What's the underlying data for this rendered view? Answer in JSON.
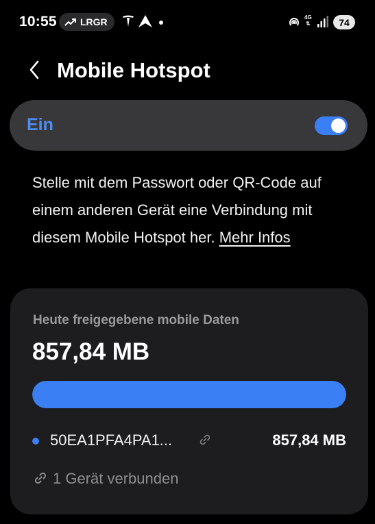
{
  "status_bar": {
    "time": "10:55",
    "pill_label": "LRGR",
    "pill_icon": "trending-up-icon",
    "network_type_top": "4G",
    "network_type_bottom": "⇅",
    "battery": "74"
  },
  "header": {
    "title": "Mobile Hotspot",
    "back_icon": "chevron-left-icon"
  },
  "toggle": {
    "label": "Ein",
    "state": "on",
    "accent_color": "#4f8cf0"
  },
  "description": {
    "text": "Stelle mit dem Passwort oder QR-Code auf einem anderen Gerät eine Verbindung mit diesem Mobile Hotspot her.",
    "link": "Mehr Infos"
  },
  "data_card": {
    "heading": "Heute freigegebene mobile Daten",
    "total": "857,84 MB",
    "usage_fraction": 1.0,
    "bar_color": "#3b7ff5",
    "devices": [
      {
        "name": "50EA1PFA4PA1...",
        "usage": "857,84 MB",
        "icon": "link-icon"
      }
    ],
    "connected_text": "1 Gerät verbunden"
  }
}
